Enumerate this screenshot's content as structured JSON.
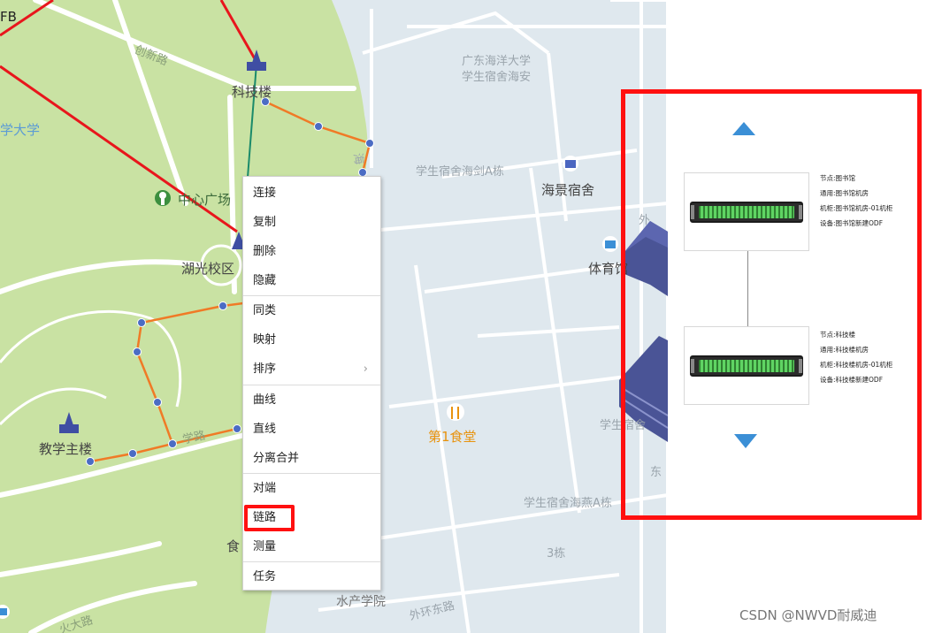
{
  "map": {
    "labels": {
      "chuangxin_road": "创新路",
      "keji_building": "科技楼",
      "university_partial": "学大学",
      "center_square": "中心广场",
      "huguang_campus": "湖光校区",
      "teaching_main_building": "教学主楼",
      "road_partial_mid": "学路",
      "canteen_partial": "食",
      "road_partial_bottom": "火大路",
      "top_left_partial": "FB",
      "ocean_univ_line1": "广东海洋大学",
      "ocean_univ_line2": "学生宿舍海安",
      "dorm_haishen_a": "学生宿舍海剑A栋",
      "haijing_dorm": "海景宿舍",
      "outer_partial": "外",
      "gym": "体育馆",
      "first_canteen": "第1食堂",
      "dorm_partial_right": "学生宿舍",
      "east_partial": "东",
      "dorm_haiyan_a": "学生宿舍海燕A栋",
      "building_3": "3栋",
      "fisheries_college": "水产学院",
      "outer_ring_east_road": "外环东路",
      "dorm_partial_left": "海"
    }
  },
  "context_menu": {
    "items": [
      {
        "label": "连接"
      },
      {
        "label": "复制"
      },
      {
        "label": "删除"
      },
      {
        "label": "隐藏"
      },
      {
        "label": "同类"
      },
      {
        "label": "映射"
      },
      {
        "label": "排序",
        "submenu": true
      },
      {
        "label": "曲线"
      },
      {
        "label": "直线"
      },
      {
        "label": "分离合并"
      },
      {
        "label": "对端"
      },
      {
        "label": "链路",
        "highlighted": true
      },
      {
        "label": "测量"
      },
      {
        "label": "任务"
      }
    ]
  },
  "link_panel": {
    "top_node": {
      "node": "节点:图书馆",
      "room": "通用:图书馆机房",
      "cabinet": "机柜:图书馆机房-01机柜",
      "device": "设备:图书馆新建ODF"
    },
    "bottom_node": {
      "node": "节点:科技楼",
      "room": "通用:科技楼机房",
      "cabinet": "机柜:科技楼机房-01机柜",
      "device": "设备:科技楼新建ODF"
    }
  },
  "watermark": "CSDN @NWVD耐威迪",
  "colors": {
    "highlight": "#ff1010",
    "arrow": "#3b8fd6",
    "green_area": "#c9e2a3",
    "water": "#dfe8ee",
    "route_red": "#e8161c",
    "route_orange": "#f07a26"
  }
}
